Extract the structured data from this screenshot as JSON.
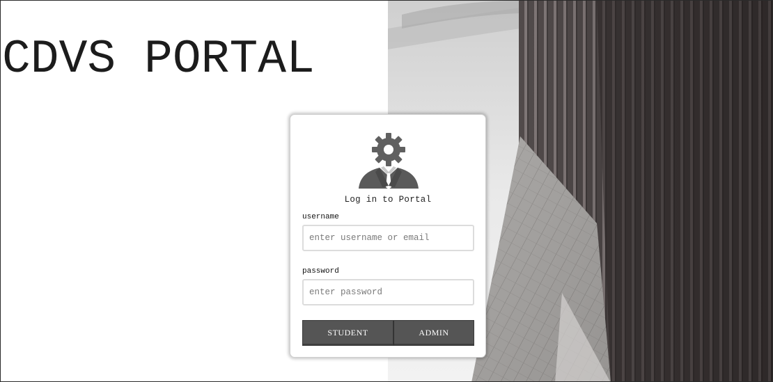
{
  "site": {
    "title": "CDVS PORTAL"
  },
  "login": {
    "heading": "Log in to Portal",
    "username": {
      "label": "username",
      "placeholder": "enter username or email",
      "value": ""
    },
    "password": {
      "label": "password",
      "placeholder": "enter password",
      "value": ""
    },
    "buttons": {
      "student": "STUDENT",
      "admin": "ADMIN"
    }
  },
  "icons": {
    "avatar": "user-gear-icon"
  },
  "colors": {
    "button_bg": "#555555",
    "button_text": "#ffffff",
    "title_text": "#1c1c1c"
  }
}
